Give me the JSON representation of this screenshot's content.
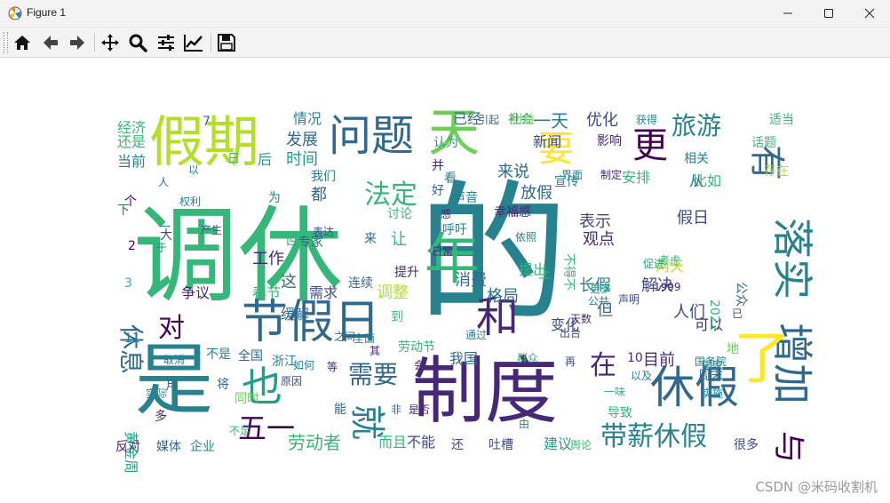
{
  "window": {
    "title": "Figure 1",
    "minimize_icon": "minimize-icon",
    "maximize_icon": "maximize-icon",
    "close_icon": "close-icon"
  },
  "toolbar": {
    "tools": [
      "home-icon",
      "back-arrow-icon",
      "forward-arrow-icon",
      "pan-icon",
      "zoom-icon",
      "subplots-config-icon",
      "axes-edit-icon",
      "save-icon"
    ]
  },
  "wordcloud": {
    "words": [
      "调休",
      "的",
      "假期",
      "制度",
      "是",
      "节假日",
      "天",
      "问题",
      "年",
      "增加",
      "落实",
      "休假",
      "带薪休假",
      "和",
      "也",
      "有",
      "要",
      "旅游",
      "更",
      "就",
      "与",
      "了",
      "法定",
      "需要",
      "劳动者",
      "五一",
      "休息",
      "在",
      "对",
      "都",
      "我们",
      "时间",
      "情况",
      "经济",
      "还是",
      "当前",
      "发展",
      "一天",
      "优化",
      "新闻",
      "来说",
      "放假",
      "安排",
      "假日",
      "比如",
      "相关",
      "从",
      "宣传",
      "获得",
      "表示",
      "观点",
      "长假",
      "但",
      "解决",
      "人们",
      "目前",
      "可以",
      "消费",
      "格局",
      "春节",
      "工作",
      "调整",
      "需求",
      "争议",
      "黄金周",
      "媒体",
      "企业",
      "反对",
      "而且",
      "不能",
      "吐槽",
      "我国",
      "已经",
      "社会",
      "认为",
      "这",
      "让",
      "提出",
      "变化",
      "两天",
      "周末",
      "不得不",
      "幸福感",
      "依照",
      "回应",
      "缓解",
      "能",
      "多",
      "不是",
      "全国",
      "以及",
      "一味",
      "导致",
      "很多",
      "舆论",
      "建议",
      "再",
      "话题",
      "存在",
      "适当",
      "群众",
      "劳动节",
      "1999",
      "2022",
      "公众",
      "提升",
      "国家",
      "国务院",
      "专家",
      "表达",
      "同时",
      "将",
      "不足",
      "还",
      "由",
      "会",
      "等",
      "其",
      "全面",
      "之间",
      "如何",
      "原因",
      "取消",
      "实际",
      "权利",
      "出台",
      "公共",
      "界面",
      "制定",
      "引起",
      "促进",
      "利益",
      "声音",
      "看",
      "并",
      "到",
      "来",
      "地",
      "影响",
      "感",
      "大",
      "10",
      "11",
      "7",
      "3",
      "2",
      "个",
      "一",
      "于",
      "为",
      "好",
      "产生",
      "呼吁",
      "以",
      "人",
      "下",
      "后",
      "上",
      "日",
      "月",
      "日常",
      "非",
      "是否",
      "通过",
      "天数",
      "讨论",
      "考虑",
      "已",
      "更多",
      "连续",
      "浙江",
      "声明",
      "实施",
      "小",
      "中",
      "可",
      "地方",
      "之后",
      "进行",
      "一年",
      "作为",
      "不",
      "休闲",
      "国民",
      "假",
      "时",
      "更加",
      "是",
      "更"
    ],
    "watermark": "CSDN @米码收割机",
    "palette": [
      "#440154",
      "#472878",
      "#3e4989",
      "#31688e",
      "#26828e",
      "#1f9e89",
      "#35b779",
      "#6ece58",
      "#b5de2b",
      "#fde725"
    ]
  }
}
